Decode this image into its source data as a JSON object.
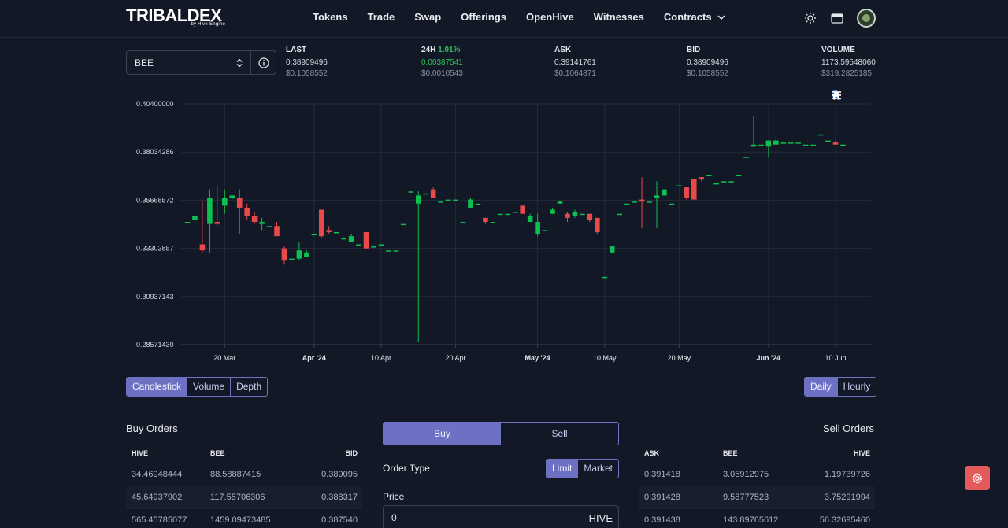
{
  "header": {
    "logo": "TRIBALDEX",
    "logo_sub": "by Hive-Engine",
    "nav": [
      "Tokens",
      "Trade",
      "Swap",
      "Offerings",
      "OpenHive",
      "Witnesses",
      "Contracts"
    ]
  },
  "ticker": {
    "pair": "BEE",
    "last": {
      "label": "LAST",
      "value": "0.38909496",
      "usd": "$0.1058552"
    },
    "change": {
      "label": "24H",
      "pct": "1.01%",
      "value": "0.00387541",
      "usd": "$0.0010543"
    },
    "ask": {
      "label": "ASK",
      "value": "0.39141761",
      "usd": "$0.1064871"
    },
    "bid": {
      "label": "BID",
      "value": "0.38909496",
      "usd": "$0.1058552"
    },
    "volume": {
      "label": "VOLUME",
      "value": "1173.59548060",
      "usd": "$319.2825185"
    }
  },
  "chart_data": {
    "type": "candlestick",
    "y_ticks": [
      "0.40400000",
      "0.38034286",
      "0.35668572",
      "0.33302857",
      "0.30937143",
      "0.28571430"
    ],
    "ylim": [
      0.2857143,
      0.404
    ],
    "x_ticks": [
      {
        "label": "20 Mar",
        "day": 5,
        "bold": false
      },
      {
        "label": "Apr '24",
        "day": 17,
        "bold": true
      },
      {
        "label": "10 Apr",
        "day": 26,
        "bold": false
      },
      {
        "label": "20 Apr",
        "day": 36,
        "bold": false
      },
      {
        "label": "May '24",
        "day": 47,
        "bold": true
      },
      {
        "label": "10 May",
        "day": 56,
        "bold": false
      },
      {
        "label": "20 May",
        "day": 66,
        "bold": false
      },
      {
        "label": "Jun '24",
        "day": 78,
        "bold": true
      },
      {
        "label": "10 Jun",
        "day": 87,
        "bold": false
      }
    ],
    "candles": [
      [
        0.346,
        0.346,
        0.346,
        0.346
      ],
      [
        0.347,
        0.349,
        0.351,
        0.345
      ],
      [
        0.335,
        0.332,
        0.356,
        0.331
      ],
      [
        0.345,
        0.358,
        0.362,
        0.331
      ],
      [
        0.346,
        0.345,
        0.364,
        0.344
      ],
      [
        0.354,
        0.358,
        0.362,
        0.35
      ],
      [
        0.358,
        0.359,
        0.359,
        0.357
      ],
      [
        0.358,
        0.353,
        0.362,
        0.34
      ],
      [
        0.353,
        0.349,
        0.355,
        0.347
      ],
      [
        0.349,
        0.346,
        0.351,
        0.345
      ],
      [
        0.345,
        0.346,
        0.348,
        0.342
      ],
      [
        0.344,
        0.344,
        0.344,
        0.344
      ],
      [
        0.344,
        0.339,
        0.346,
        0.339
      ],
      [
        0.333,
        0.327,
        0.334,
        0.325
      ],
      [
        0.328,
        0.328,
        0.328,
        0.328
      ],
      [
        0.328,
        0.332,
        0.336,
        0.327
      ],
      [
        0.329,
        0.331,
        0.332,
        0.329
      ],
      [
        0.34,
        0.34,
        0.34,
        0.34
      ],
      [
        0.352,
        0.339,
        0.352,
        0.338
      ],
      [
        0.342,
        0.341,
        0.344,
        0.34
      ],
      [
        0.341,
        0.341,
        0.341,
        0.341
      ],
      [
        0.338,
        0.338,
        0.338,
        0.338
      ],
      [
        0.336,
        0.339,
        0.34,
        0.336
      ],
      [
        0.335,
        0.335,
        0.335,
        0.335
      ],
      [
        0.341,
        0.333,
        0.341,
        0.333
      ],
      [
        0.334,
        0.334,
        0.334,
        0.334
      ],
      [
        0.335,
        0.335,
        0.335,
        0.335
      ],
      [
        0.332,
        0.332,
        0.332,
        0.332
      ],
      [
        0.332,
        0.332,
        0.332,
        0.332
      ],
      [
        0.345,
        0.345,
        0.345,
        0.345
      ],
      [
        0.361,
        0.361,
        0.361,
        0.361
      ],
      [
        0.355,
        0.359,
        0.361,
        0.287
      ],
      [
        0.36,
        0.36,
        0.36,
        0.36
      ],
      [
        0.362,
        0.358,
        0.363,
        0.358
      ],
      [
        0.356,
        0.356,
        0.356,
        0.356
      ],
      [
        0.357,
        0.357,
        0.357,
        0.357
      ],
      [
        0.357,
        0.357,
        0.357,
        0.357
      ],
      [
        0.346,
        0.346,
        0.346,
        0.346
      ],
      [
        0.353,
        0.357,
        0.358,
        0.353
      ],
      [
        0.355,
        0.355,
        0.355,
        0.355
      ],
      [
        0.348,
        0.346,
        0.348,
        0.345
      ],
      [
        0.346,
        0.346,
        0.346,
        0.346
      ],
      [
        0.35,
        0.35,
        0.35,
        0.35
      ],
      [
        0.35,
        0.35,
        0.35,
        0.35
      ],
      [
        0.351,
        0.351,
        0.351,
        0.351
      ],
      [
        0.354,
        0.35,
        0.354,
        0.35
      ],
      [
        0.346,
        0.349,
        0.35,
        0.346
      ],
      [
        0.34,
        0.346,
        0.35,
        0.339
      ],
      [
        0.342,
        0.342,
        0.342,
        0.342
      ],
      [
        0.35,
        0.352,
        0.353,
        0.35
      ],
      [
        0.355,
        0.356,
        0.356,
        0.355
      ],
      [
        0.35,
        0.348,
        0.351,
        0.346
      ],
      [
        0.349,
        0.351,
        0.352,
        0.348
      ],
      [
        0.35,
        0.35,
        0.35,
        0.35
      ],
      [
        0.35,
        0.347,
        0.35,
        0.346
      ],
      [
        0.348,
        0.341,
        0.348,
        0.34
      ],
      [
        0.319,
        0.319,
        0.319,
        0.319
      ],
      [
        0.331,
        0.334,
        0.334,
        0.331
      ],
      [
        0.35,
        0.35,
        0.35,
        0.35
      ],
      [
        0.355,
        0.355,
        0.355,
        0.355
      ],
      [
        0.356,
        0.356,
        0.356,
        0.356
      ],
      [
        0.357,
        0.356,
        0.368,
        0.343
      ],
      [
        0.356,
        0.356,
        0.356,
        0.356
      ],
      [
        0.358,
        0.359,
        0.366,
        0.343
      ],
      [
        0.359,
        0.362,
        0.362,
        0.359
      ],
      [
        0.355,
        0.355,
        0.355,
        0.355
      ],
      [
        0.364,
        0.364,
        0.364,
        0.364
      ],
      [
        0.363,
        0.358,
        0.363,
        0.357
      ],
      [
        0.367,
        0.357,
        0.367,
        0.357
      ],
      [
        0.368,
        0.367,
        0.368,
        0.366
      ],
      [
        0.369,
        0.369,
        0.369,
        0.369
      ],
      [
        0.365,
        0.365,
        0.365,
        0.365
      ],
      [
        0.366,
        0.366,
        0.366,
        0.366
      ],
      [
        0.366,
        0.366,
        0.366,
        0.366
      ],
      [
        0.369,
        0.369,
        0.369,
        0.369
      ],
      [
        0.378,
        0.378,
        0.378,
        0.378
      ],
      [
        0.383,
        0.384,
        0.398,
        0.383
      ],
      [
        0.384,
        0.384,
        0.384,
        0.384
      ],
      [
        0.383,
        0.386,
        0.386,
        0.378
      ],
      [
        0.384,
        0.386,
        0.388,
        0.384
      ],
      [
        0.385,
        0.385,
        0.385,
        0.385
      ],
      [
        0.385,
        0.385,
        0.385,
        0.385
      ],
      [
        0.385,
        0.385,
        0.385,
        0.385
      ],
      [
        0.384,
        0.384,
        0.384,
        0.384
      ],
      [
        0.384,
        0.384,
        0.384,
        0.384
      ],
      [
        0.389,
        0.389,
        0.389,
        0.389
      ],
      [
        0.386,
        0.386,
        0.386,
        0.386
      ],
      [
        0.385,
        0.384,
        0.386,
        0.384
      ],
      [
        0.384,
        0.384,
        0.384,
        0.384
      ]
    ],
    "colors": {
      "up": "#0fbf4f",
      "down": "#e84a4a",
      "grid": "#242b3a"
    }
  },
  "chart_modes": [
    "Candlestick",
    "Volume",
    "Depth"
  ],
  "intervals": [
    "Daily",
    "Hourly"
  ],
  "buy_orders": {
    "title": "Buy Orders",
    "columns": [
      "HIVE",
      "BEE",
      "BID"
    ],
    "rows": [
      [
        "34.46948444",
        "88.58887415",
        "0.389095"
      ],
      [
        "45.64937902",
        "117.55706306",
        "0.388317"
      ],
      [
        "565.45785077",
        "1459.09473485",
        "0.387540"
      ]
    ]
  },
  "sell_orders": {
    "title": "Sell Orders",
    "columns": [
      "ASK",
      "BEE",
      "HIVE"
    ],
    "rows": [
      [
        "0.391418",
        "3.05912975",
        "1.19739726"
      ],
      [
        "0.391428",
        "9.58777523",
        "3.75291994"
      ],
      [
        "0.391438",
        "143.89765612",
        "56.32695460"
      ]
    ]
  },
  "order_form": {
    "tabs": [
      "Buy",
      "Sell"
    ],
    "order_type_label": "Order Type",
    "order_types": [
      "Limit",
      "Market"
    ],
    "price_label": "Price",
    "price_value": "0",
    "price_unit": "HIVE"
  }
}
